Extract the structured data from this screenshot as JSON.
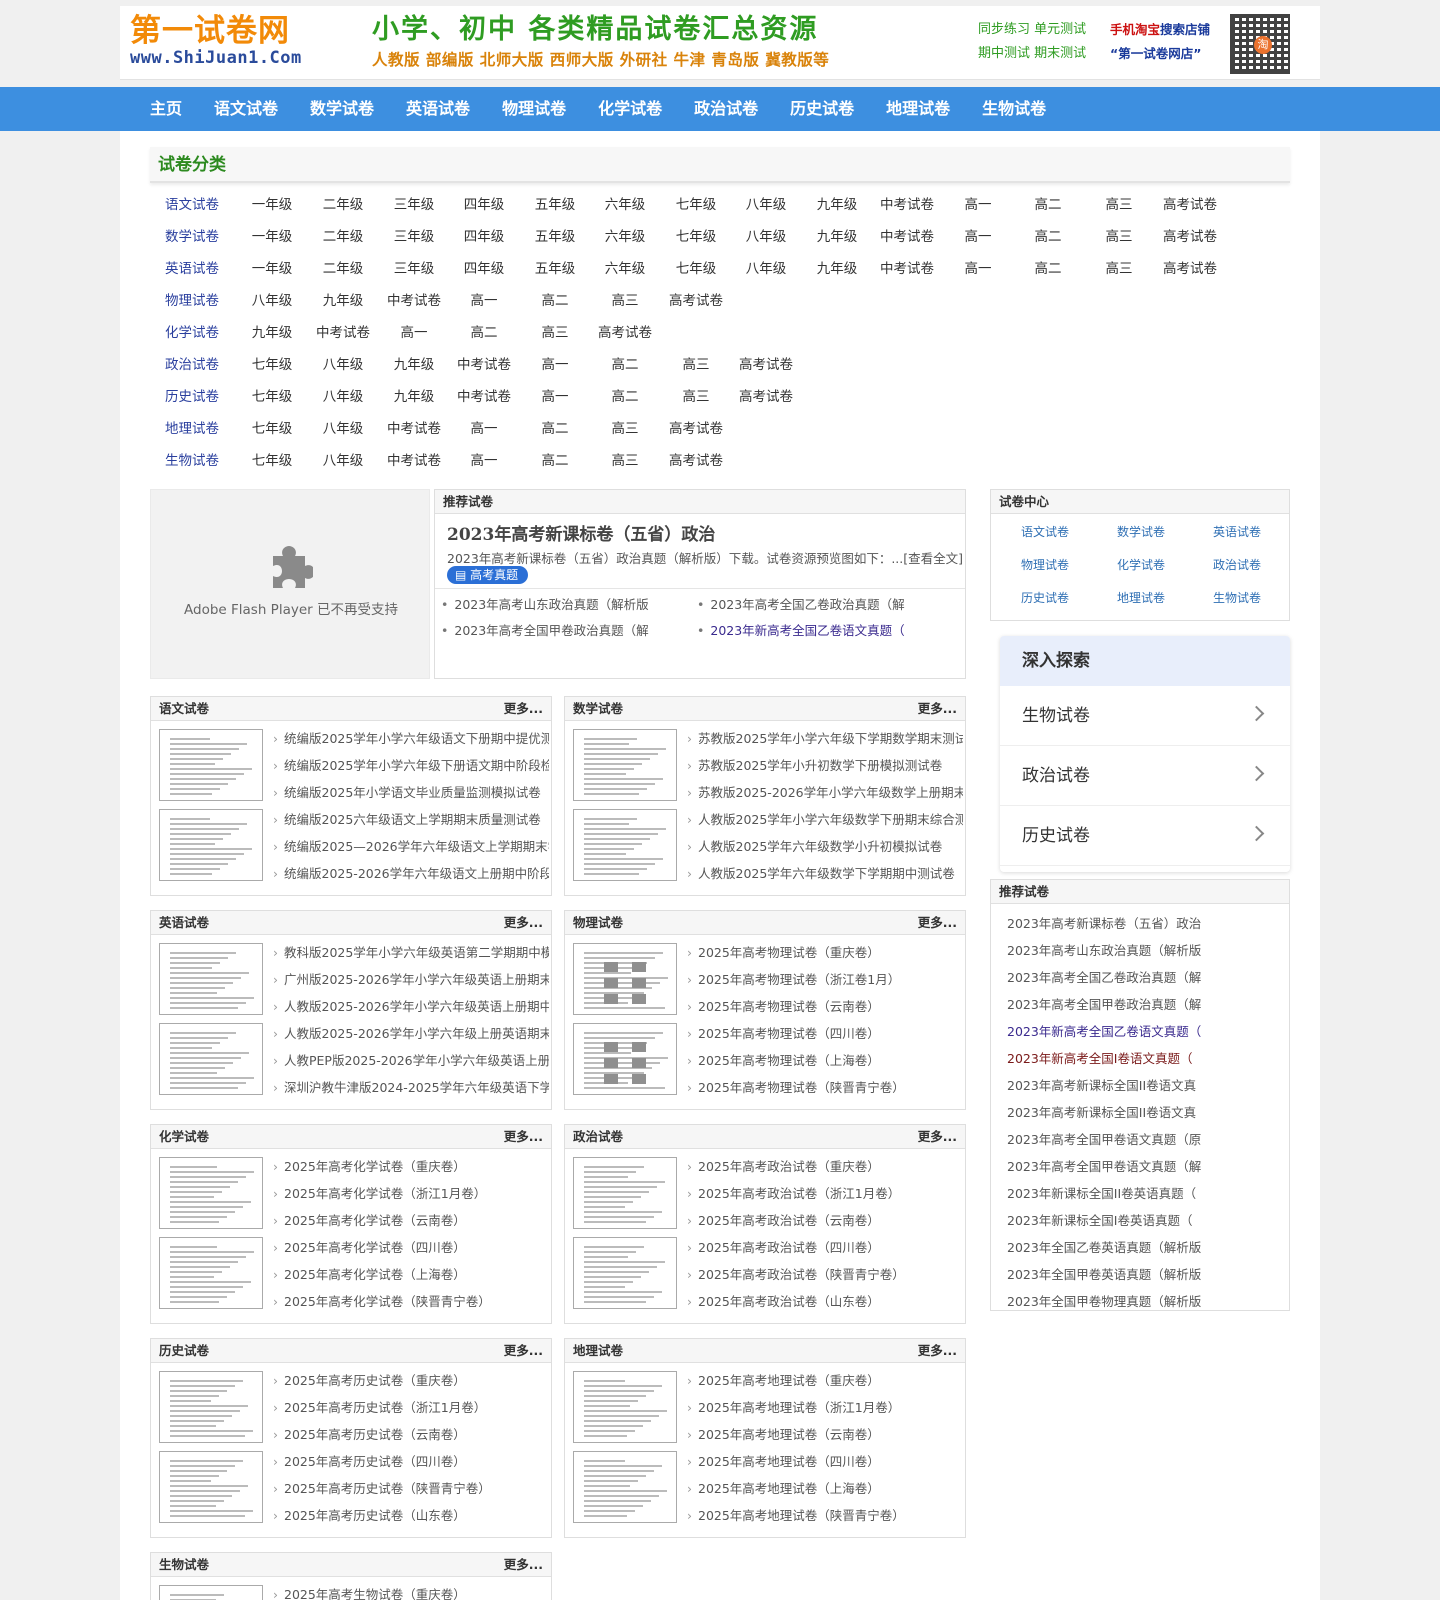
{
  "header": {
    "logo_main": "第一试卷网",
    "logo_domain": "www.ShiJuan1.Com",
    "slogan_main": "小学、初中 各类精品试卷汇总资源",
    "slogan_sub": "人教版 部编版 北师大版 西师大版 外研社 牛津 青岛版  冀教版等",
    "promo_line1": "同步练习 单元测试",
    "promo_line2": "期中测试 期末测试",
    "shop_prefix": "手机淘宝",
    "shop_search": "搜索店铺",
    "shop_name": "“第一试卷网店”"
  },
  "nav": [
    "主页",
    "语文试卷",
    "数学试卷",
    "英语试卷",
    "物理试卷",
    "化学试卷",
    "政治试卷",
    "历史试卷",
    "地理试卷",
    "生物试卷"
  ],
  "categories": {
    "title": "试卷分类",
    "rows": [
      {
        "subject": "语文试卷",
        "items": [
          "一年级",
          "二年级",
          "三年级",
          "四年级",
          "五年级",
          "六年级",
          "七年级",
          "八年级",
          "九年级",
          "中考试卷",
          "高一",
          "高二",
          "高三",
          "高考试卷"
        ]
      },
      {
        "subject": "数学试卷",
        "items": [
          "一年级",
          "二年级",
          "三年级",
          "四年级",
          "五年级",
          "六年级",
          "七年级",
          "八年级",
          "九年级",
          "中考试卷",
          "高一",
          "高二",
          "高三",
          "高考试卷"
        ]
      },
      {
        "subject": "英语试卷",
        "items": [
          "一年级",
          "二年级",
          "三年级",
          "四年级",
          "五年级",
          "六年级",
          "七年级",
          "八年级",
          "九年级",
          "中考试卷",
          "高一",
          "高二",
          "高三",
          "高考试卷"
        ]
      },
      {
        "subject": "物理试卷",
        "items": [
          "八年级",
          "九年级",
          "中考试卷",
          "高一",
          "高二",
          "高三",
          "高考试卷"
        ]
      },
      {
        "subject": "化学试卷",
        "items": [
          "九年级",
          "中考试卷",
          "高一",
          "高二",
          "高三",
          "高考试卷"
        ]
      },
      {
        "subject": "政治试卷",
        "items": [
          "七年级",
          "八年级",
          "九年级",
          "中考试卷",
          "高一",
          "高二",
          "高三",
          "高考试卷"
        ]
      },
      {
        "subject": "历史试卷",
        "items": [
          "七年级",
          "八年级",
          "九年级",
          "中考试卷",
          "高一",
          "高二",
          "高三",
          "高考试卷"
        ]
      },
      {
        "subject": "地理试卷",
        "items": [
          "七年级",
          "八年级",
          "中考试卷",
          "高一",
          "高二",
          "高三",
          "高考试卷"
        ]
      },
      {
        "subject": "生物试卷",
        "items": [
          "七年级",
          "八年级",
          "中考试卷",
          "高一",
          "高二",
          "高三",
          "高考试卷"
        ]
      }
    ]
  },
  "flash": {
    "message": "Adobe Flash Player 已不再受支持"
  },
  "recommend": {
    "heading": "推荐试卷",
    "title": "2023年高考新课标卷（五省）政治",
    "desc": "2023年高考新课标卷（五省）政治真题（解析版）下载。试卷资源预览图如下：...[查看全文]",
    "badge": "高考真题",
    "links": [
      "2023年高考山东政治真题（解析版",
      "2023年高考全国乙卷政治真题（解",
      "2023年高考全国甲卷政治真题（解",
      "2023年新高考全国乙卷语文真题（"
    ]
  },
  "test_center": {
    "heading": "试卷中心",
    "items": [
      "语文试卷",
      "数学试卷",
      "英语试卷",
      "物理试卷",
      "化学试卷",
      "政治试卷",
      "历史试卷",
      "地理试卷",
      "生物试卷"
    ]
  },
  "explore": {
    "heading": "深入探索",
    "items": [
      "生物试卷",
      "政治试卷",
      "历史试卷"
    ]
  },
  "right_recommend": {
    "heading": "推荐试卷",
    "items": [
      "2023年高考新课标卷（五省）政治",
      "2023年高考山东政治真题（解析版",
      "2023年高考全国乙卷政治真题（解",
      "2023年高考全国甲卷政治真题（解",
      "2023年新高考全国乙卷语文真题（",
      "2023年新高考全国I卷语文真题（",
      "2023年高考新课标全国II卷语文真",
      "2023年高考新课标全国II卷语文真",
      "2023年高考全国甲卷语文真题（原",
      "2023年高考全国甲卷语文真题（解",
      "2023年新课标全国II卷英语真题（",
      "2023年新课标全国I卷英语真题（",
      "2023年全国乙卷英语真题（解析版",
      "2023年全国甲卷英语真题（解析版",
      "2023年全国甲卷物理真题（解析版"
    ]
  },
  "more_label": "更多...",
  "subjects": [
    {
      "name": "语文试卷",
      "items": [
        "统编版2025学年小学六年级语文下册期中提优测",
        "统编版2025学年小学六年级下册语文期中阶段检",
        "统编版2025年小学语文毕业质量监测模拟试卷",
        "统编版2025六年级语文上学期期末质量测试卷",
        "统编版2025—2026学年六年级语文上学期期末学",
        "统编版2025-2026学年六年级语文上册期中阶段"
      ]
    },
    {
      "name": "数学试卷",
      "items": [
        "苏教版2025学年小学六年级下学期数学期末测试",
        "苏教版2025学年小升初数学下册模拟测试卷",
        "苏教版2025-2026学年小学六年级数学上册期末",
        "人教版2025学年小学六年级数学下册期末综合测",
        "人教版2025学年六年级数学小升初模拟试卷",
        "人教版2025学年六年级数学下学期期中测试卷"
      ]
    },
    {
      "name": "英语试卷",
      "items": [
        "教科版2025学年小学六年级英语第二学期期中模",
        "广州版2025-2026学年小学六年级英语上册期末",
        "人教版2025-2026学年小学六年级英语上册期中",
        "人教版2025-2026学年小学六年级上册英语期末",
        "人教PEP版2025-2026学年小学六年级英语上册",
        "深圳沪教牛津版2024-2025学年六年级英语下学"
      ]
    },
    {
      "name": "物理试卷",
      "items": [
        "2025年高考物理试卷（重庆卷）",
        "2025年高考物理试卷（浙江卷1月）",
        "2025年高考物理试卷（云南卷）",
        "2025年高考物理试卷（四川卷）",
        "2025年高考物理试卷（上海卷）",
        "2025年高考物理试卷（陕晋青宁卷）"
      ]
    },
    {
      "name": "化学试卷",
      "items": [
        "2025年高考化学试卷（重庆卷）",
        "2025年高考化学试卷（浙江1月卷）",
        "2025年高考化学试卷（云南卷）",
        "2025年高考化学试卷（四川卷）",
        "2025年高考化学试卷（上海卷）",
        "2025年高考化学试卷（陕晋青宁卷）"
      ]
    },
    {
      "name": "政治试卷",
      "items": [
        "2025年高考政治试卷（重庆卷）",
        "2025年高考政治试卷（浙江1月卷）",
        "2025年高考政治试卷（云南卷）",
        "2025年高考政治试卷（四川卷）",
        "2025年高考政治试卷（陕晋青宁卷）",
        "2025年高考政治试卷（山东卷）"
      ]
    },
    {
      "name": "历史试卷",
      "items": [
        "2025年高考历史试卷（重庆卷）",
        "2025年高考历史试卷（浙江1月卷）",
        "2025年高考历史试卷（云南卷）",
        "2025年高考历史试卷（四川卷）",
        "2025年高考历史试卷（陕晋青宁卷）",
        "2025年高考历史试卷（山东卷）"
      ]
    },
    {
      "name": "地理试卷",
      "items": [
        "2025年高考地理试卷（重庆卷）",
        "2025年高考地理试卷（浙江1月卷）",
        "2025年高考地理试卷（云南卷）",
        "2025年高考地理试卷（四川卷）",
        "2025年高考地理试卷（上海卷）",
        "2025年高考地理试卷（陕晋青宁卷）"
      ]
    },
    {
      "name": "生物试卷",
      "items": [
        "2025年高考生物试卷（重庆卷）"
      ]
    }
  ]
}
